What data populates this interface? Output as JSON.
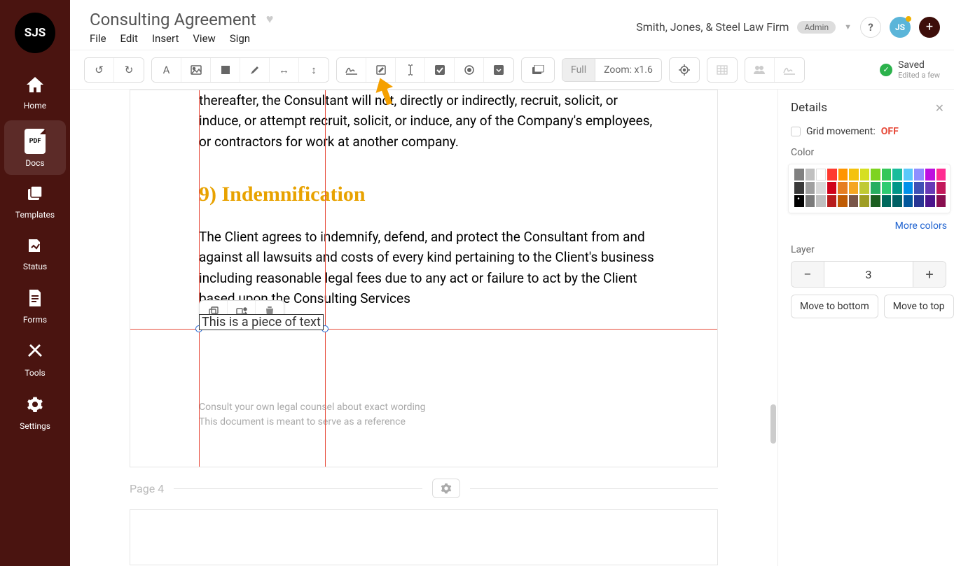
{
  "header": {
    "doc_title": "Consulting Agreement",
    "menu": {
      "file": "File",
      "edit": "Edit",
      "insert": "Insert",
      "view": "View",
      "sign": "Sign"
    },
    "firm_name": "Smith, Jones, & Steel Law Firm",
    "role_badge": "Admin",
    "avatar_initials": "JS",
    "help_label": "?"
  },
  "sidebar": {
    "logo_text": "SJS",
    "items": [
      {
        "label": "Home"
      },
      {
        "label": "Docs"
      },
      {
        "label": "Templates"
      },
      {
        "label": "Status"
      },
      {
        "label": "Forms"
      },
      {
        "label": "Tools"
      },
      {
        "label": "Settings"
      }
    ]
  },
  "toolbar": {
    "zoom_full": "Full",
    "zoom_value": "Zoom: x1.6",
    "saved_title": "Saved",
    "saved_sub": "Edited a few"
  },
  "document": {
    "para1": "thereafter, the Consultant will not, directly or indirectly, recruit, solicit, or induce, or attempt recruit, solicit, or induce, any of the Company's employees, or contractors for work at another company.",
    "heading": "9) Indemnification",
    "para2": "The Client agrees to indemnify, defend, and protect the Consultant from and against all lawsuits and costs of every kind pertaining to the Client's business including reasonable legal fees due to any act or failure to act by the Client based upon the Consulting Services",
    "selected_text": "This is a piece of text",
    "footer1": "Consult your own legal counsel about exact wording",
    "footer2": "This document is meant to serve as a reference",
    "page_label": "Page 4"
  },
  "panel": {
    "title": "Details",
    "grid_label": "Grid movement:",
    "grid_state": "OFF",
    "color_label": "Color",
    "more_colors": "More colors",
    "layer_label": "Layer",
    "layer_value": "3",
    "move_bottom": "Move to bottom",
    "move_top": "Move to top",
    "colors_row1": [
      "#808080",
      "#c0c0c0",
      "#ffffff",
      "#ff3b30",
      "#ff9500",
      "#f4c20d",
      "#d6df22",
      "#7ed321",
      "#34c759",
      "#1abc9c",
      "#5ac8fa",
      "#8e8eff",
      "#bd10e0",
      "#ff2d92"
    ],
    "colors_row2": [
      "#3a3a3a",
      "#a0a0a0",
      "#d9d9d9",
      "#d0021b",
      "#e67e22",
      "#f5a623",
      "#c0ca33",
      "#27ae60",
      "#2ecc71",
      "#009688",
      "#0091ea",
      "#3f51b5",
      "#673ab7",
      "#c2185b"
    ],
    "colors_row3": [
      "#000000",
      "#7a7a7a",
      "#bfbfbf",
      "#b71c1c",
      "#bf5b04",
      "#795548",
      "#9e9d24",
      "#1b5e20",
      "#00695c",
      "#006064",
      "#01579b",
      "#283593",
      "#4a148c",
      "#880e4f"
    ]
  }
}
